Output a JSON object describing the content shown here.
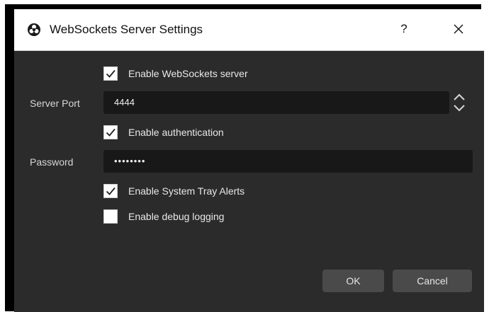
{
  "dialog": {
    "title": "WebSockets Server Settings",
    "help_label": "?"
  },
  "form": {
    "enable_server": {
      "label": "Enable WebSockets server",
      "checked": true
    },
    "server_port": {
      "label": "Server Port",
      "value": "4444"
    },
    "enable_auth": {
      "label": "Enable authentication",
      "checked": true
    },
    "password": {
      "label": "Password",
      "value": "••••••••"
    },
    "tray_alerts": {
      "label": "Enable System Tray Alerts",
      "checked": true
    },
    "debug_logging": {
      "label": "Enable debug logging",
      "checked": false
    }
  },
  "buttons": {
    "ok": "OK",
    "cancel": "Cancel"
  },
  "colors": {
    "dialog_bg": "#2b2b2b",
    "input_bg": "#181818",
    "button_bg": "#4a4a4a",
    "titlebar_bg": "#ffffff"
  },
  "icons": {
    "app": "obs-logo-icon",
    "close": "close-icon",
    "check": "check-icon",
    "spin_up": "chevron-up-icon",
    "spin_down": "chevron-down-icon"
  }
}
